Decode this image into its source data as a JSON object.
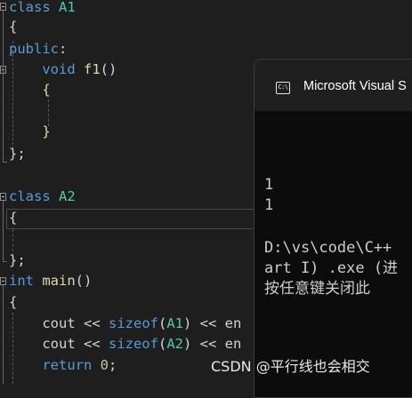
{
  "code_lines": [
    {
      "tokens": [
        {
          "t": "class ",
          "c": "kw"
        },
        {
          "t": "A1",
          "c": "ty"
        }
      ]
    },
    {
      "tokens": [
        {
          "t": "{",
          "c": "pl"
        }
      ]
    },
    {
      "tokens": [
        {
          "t": "public",
          "c": "kw"
        },
        {
          "t": ":",
          "c": "pl"
        }
      ]
    },
    {
      "tokens": [
        {
          "t": "    ",
          "c": "pl"
        },
        {
          "t": "void ",
          "c": "kw"
        },
        {
          "t": "f1",
          "c": "fn"
        },
        {
          "t": "()",
          "c": "pl"
        }
      ]
    },
    {
      "tokens": [
        {
          "t": "    ",
          "c": "pl"
        },
        {
          "t": "{",
          "c": "br"
        }
      ]
    },
    {
      "tokens": []
    },
    {
      "tokens": [
        {
          "t": "    ",
          "c": "pl"
        },
        {
          "t": "}",
          "c": "br"
        }
      ]
    },
    {
      "tokens": [
        {
          "t": "};",
          "c": "pl"
        }
      ]
    },
    {
      "tokens": []
    },
    {
      "tokens": [
        {
          "t": "class ",
          "c": "kw"
        },
        {
          "t": "A2",
          "c": "ty"
        }
      ]
    },
    {
      "tokens": [
        {
          "t": "{",
          "c": "pl"
        }
      ]
    },
    {
      "tokens": []
    },
    {
      "tokens": [
        {
          "t": "};",
          "c": "pl"
        }
      ]
    },
    {
      "tokens": [
        {
          "t": "int ",
          "c": "kw"
        },
        {
          "t": "main",
          "c": "fn"
        },
        {
          "t": "()",
          "c": "pl"
        }
      ]
    },
    {
      "tokens": [
        {
          "t": "{",
          "c": "pl"
        }
      ]
    },
    {
      "tokens": []
    },
    {
      "tokens": [
        {
          "t": "    ",
          "c": "pl"
        },
        {
          "t": "cout ",
          "c": "pl"
        },
        {
          "t": "<< ",
          "c": "pl"
        },
        {
          "t": "sizeof",
          "c": "kw"
        },
        {
          "t": "(",
          "c": "pl"
        },
        {
          "t": "A1",
          "c": "ty"
        },
        {
          "t": ") << en",
          "c": "pl"
        }
      ]
    },
    {
      "tokens": [
        {
          "t": "    ",
          "c": "pl"
        },
        {
          "t": "cout ",
          "c": "pl"
        },
        {
          "t": "<< ",
          "c": "pl"
        },
        {
          "t": "sizeof",
          "c": "kw"
        },
        {
          "t": "(",
          "c": "pl"
        },
        {
          "t": "A2",
          "c": "ty"
        },
        {
          "t": ") << en",
          "c": "pl"
        }
      ]
    },
    {
      "tokens": [
        {
          "t": "    ",
          "c": "pl"
        },
        {
          "t": "return ",
          "c": "kw"
        },
        {
          "t": "0",
          "c": "nu"
        },
        {
          "t": ";",
          "c": "pl"
        }
      ]
    }
  ],
  "console": {
    "title": "Microsoft Visual S",
    "icon_label": "C:\\",
    "lines": [
      "1",
      "1",
      "",
      "D:\\vs\\code\\C++",
      "art I) .exe (进",
      "按任意键关闭此"
    ]
  },
  "watermark": "CSDN @平行线也会相交",
  "colors": {
    "editor_bg": "#1e1e1e",
    "keyword": "#569cd6",
    "type": "#4ec9b0",
    "function": "#dcdcaa",
    "plain": "#d4d4d4",
    "number": "#b5cea8",
    "console_bg": "#0c0c0c",
    "titlebar_bg": "#1f1f1f"
  }
}
